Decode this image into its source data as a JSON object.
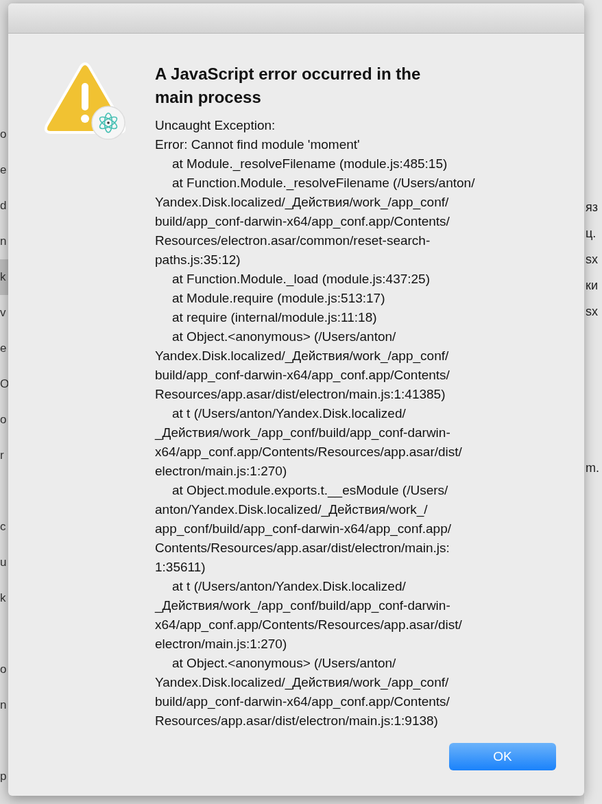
{
  "background_window": {
    "left_groups": [
      [
        {
          "text": "o",
          "selected": false
        },
        {
          "text": "e",
          "selected": false
        },
        {
          "text": "d",
          "selected": false
        },
        {
          "text": "n",
          "selected": false
        },
        {
          "text": "k",
          "selected": true
        },
        {
          "text": "v",
          "selected": false
        },
        {
          "text": "e",
          "selected": false
        },
        {
          "text": "O",
          "selected": false
        },
        {
          "text": "o",
          "selected": false
        },
        {
          "text": "r",
          "selected": false
        }
      ],
      [
        {
          "text": "c",
          "selected": false
        },
        {
          "text": "u",
          "selected": false
        },
        {
          "text": "k",
          "selected": false
        }
      ],
      [
        {
          "text": "o",
          "selected": false
        },
        {
          "text": "n",
          "selected": false
        }
      ],
      [
        {
          "text": "p",
          "selected": false
        }
      ]
    ],
    "right_groups": [
      [
        {
          "text": "яз"
        },
        {
          "text": "ц."
        },
        {
          "text": "sx"
        },
        {
          "text": "ки"
        },
        {
          "text": "sx"
        }
      ],
      [
        {
          "text": "m."
        }
      ]
    ]
  },
  "dialog": {
    "title_lines": [
      "A JavaScript error occurred in the",
      "main process"
    ],
    "frames": [
      {
        "indent": false,
        "lines": [
          "Uncaught Exception:"
        ]
      },
      {
        "indent": false,
        "lines": [
          "Error: Cannot find module 'moment'"
        ]
      },
      {
        "indent": true,
        "lines": [
          "at Module._resolveFilename (module.js:485:15)"
        ]
      },
      {
        "indent": true,
        "lines": [
          "at Function.Module._resolveFilename (/Users/anton/",
          "Yandex.Disk.localized/_Действия/work_/app_conf/",
          "build/app_conf-darwin-x64/app_conf.app/Contents/",
          "Resources/electron.asar/common/reset-search-",
          "paths.js:35:12)"
        ]
      },
      {
        "indent": true,
        "lines": [
          "at Function.Module._load (module.js:437:25)"
        ]
      },
      {
        "indent": true,
        "lines": [
          "at Module.require (module.js:513:17)"
        ]
      },
      {
        "indent": true,
        "lines": [
          "at require (internal/module.js:11:18)"
        ]
      },
      {
        "indent": true,
        "lines": [
          "at Object.<anonymous> (/Users/anton/",
          "Yandex.Disk.localized/_Действия/work_/app_conf/",
          "build/app_conf-darwin-x64/app_conf.app/Contents/",
          "Resources/app.asar/dist/electron/main.js:1:41385)"
        ]
      },
      {
        "indent": true,
        "lines": [
          "at t (/Users/anton/Yandex.Disk.localized/",
          "_Действия/work_/app_conf/build/app_conf-darwin-",
          "x64/app_conf.app/Contents/Resources/app.asar/dist/",
          "electron/main.js:1:270)"
        ]
      },
      {
        "indent": true,
        "lines": [
          "at Object.module.exports.t.__esModule (/Users/",
          "anton/Yandex.Disk.localized/_Действия/work_/",
          "app_conf/build/app_conf-darwin-x64/app_conf.app/",
          "Contents/Resources/app.asar/dist/electron/main.js:",
          "1:35611)"
        ]
      },
      {
        "indent": true,
        "lines": [
          "at t (/Users/anton/Yandex.Disk.localized/",
          "_Действия/work_/app_conf/build/app_conf-darwin-",
          "x64/app_conf.app/Contents/Resources/app.asar/dist/",
          "electron/main.js:1:270)"
        ]
      },
      {
        "indent": true,
        "lines": [
          "at Object.<anonymous> (/Users/anton/",
          "Yandex.Disk.localized/_Действия/work_/app_conf/",
          "build/app_conf-darwin-x64/app_conf.app/Contents/",
          "Resources/app.asar/dist/electron/main.js:1:9138)"
        ]
      }
    ],
    "buttons": [
      "OK"
    ]
  }
}
